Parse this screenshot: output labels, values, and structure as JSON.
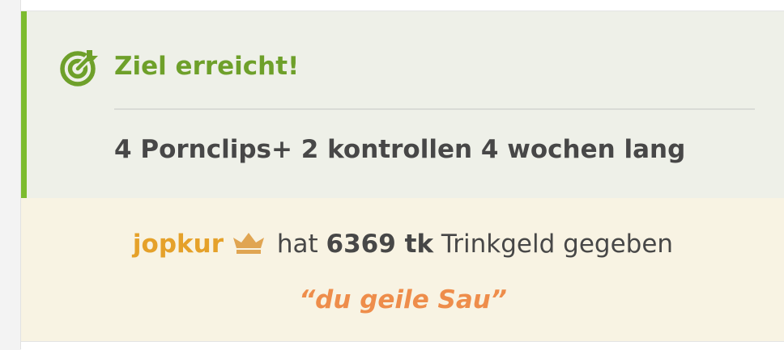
{
  "goal": {
    "icon": "target-arrow-icon",
    "title": "Ziel erreicht!",
    "description": "4 Pornclips+ 2 kontrollen 4 wochen lang",
    "accent_color": "#7cbb2e",
    "title_color": "#6ea02a"
  },
  "tip": {
    "username": "jopkur",
    "badge_icon": "crown-icon",
    "verb": "hat",
    "amount": "6369 tk",
    "action": "Trinkgeld gegeben",
    "message": "“du geile Sau”",
    "username_color": "#e5a12a",
    "message_color": "#ee8d4b"
  }
}
